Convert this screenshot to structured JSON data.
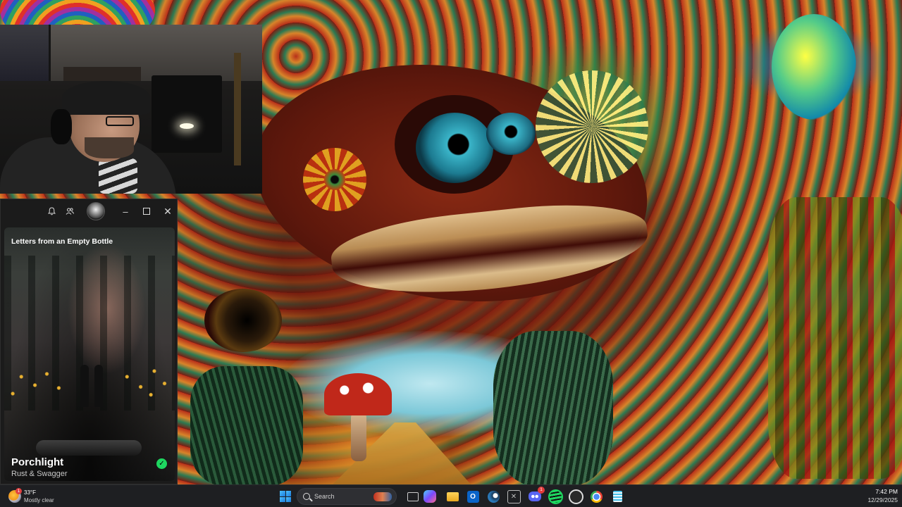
{
  "desktop": {
    "wallpaper": "psychedelic-mushroom-creature-art"
  },
  "webcam": {
    "description_icon": "webcam-feed"
  },
  "player": {
    "titlebar": {
      "bell_icon": "bell-icon",
      "friends_icon": "friends-icon",
      "avatar": "user-avatar",
      "minimize": "–",
      "close": "✕"
    },
    "album_title": "Letters from an Empty Bottle",
    "track_title": "Porchlight",
    "artist": "Rust & Swagger",
    "saved_icon": "✓",
    "accent": "#1ed760"
  },
  "taskbar": {
    "weather": {
      "temperature": "33°F",
      "condition": "Mostly clear",
      "badge": "1"
    },
    "search_label": "Search",
    "discord_badge": "1",
    "clock": {
      "time": "7:42 PM",
      "date": "12/29/2025"
    },
    "accent": "#4cc2ff"
  }
}
